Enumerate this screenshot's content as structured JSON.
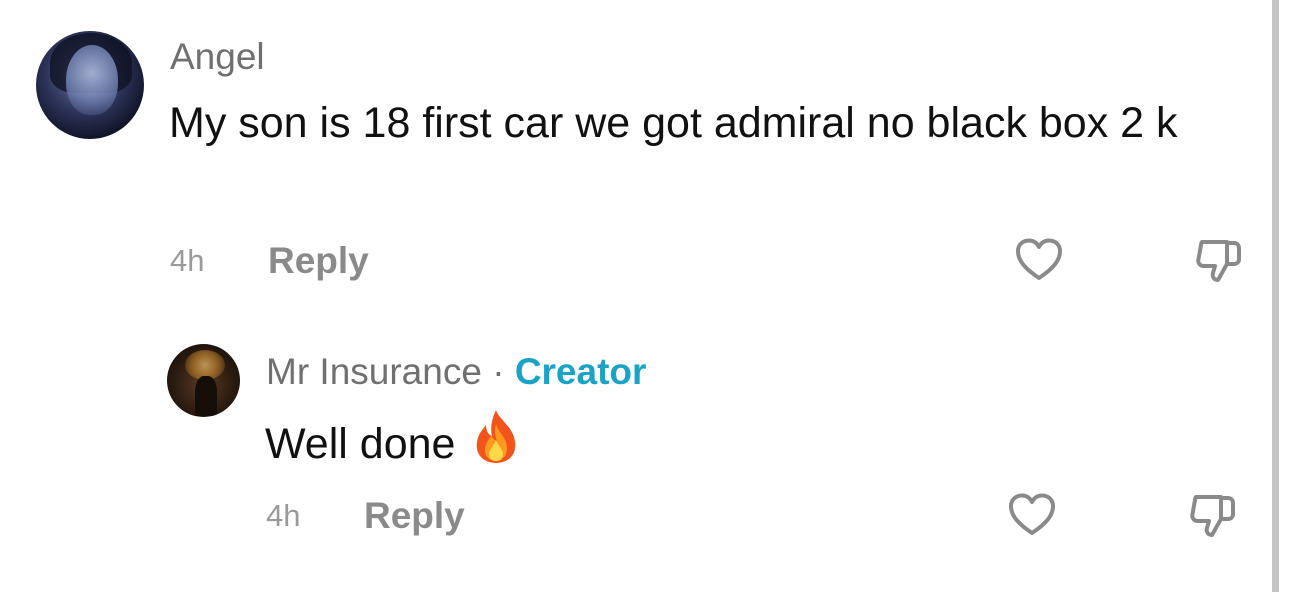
{
  "comments": [
    {
      "username": "Angel",
      "text": "My son is 18 first car we got admiral no black box 2 k",
      "time": "4h",
      "reply_label": "Reply",
      "avatar_icon": "user-avatar",
      "like_icon": "heart-icon",
      "dislike_icon": "thumbs-down-icon"
    },
    {
      "username": "Mr Insurance",
      "separator": "·",
      "creator_badge": "Creator",
      "text": "Well done",
      "emoji": "fire-emoji",
      "time": "4h",
      "reply_label": "Reply",
      "avatar_icon": "user-avatar",
      "like_icon": "heart-icon",
      "dislike_icon": "thumbs-down-icon"
    }
  ],
  "colors": {
    "creator_accent": "#1aa3c4",
    "username": "#707070",
    "text": "#111111",
    "meta": "#9a9a9a"
  }
}
